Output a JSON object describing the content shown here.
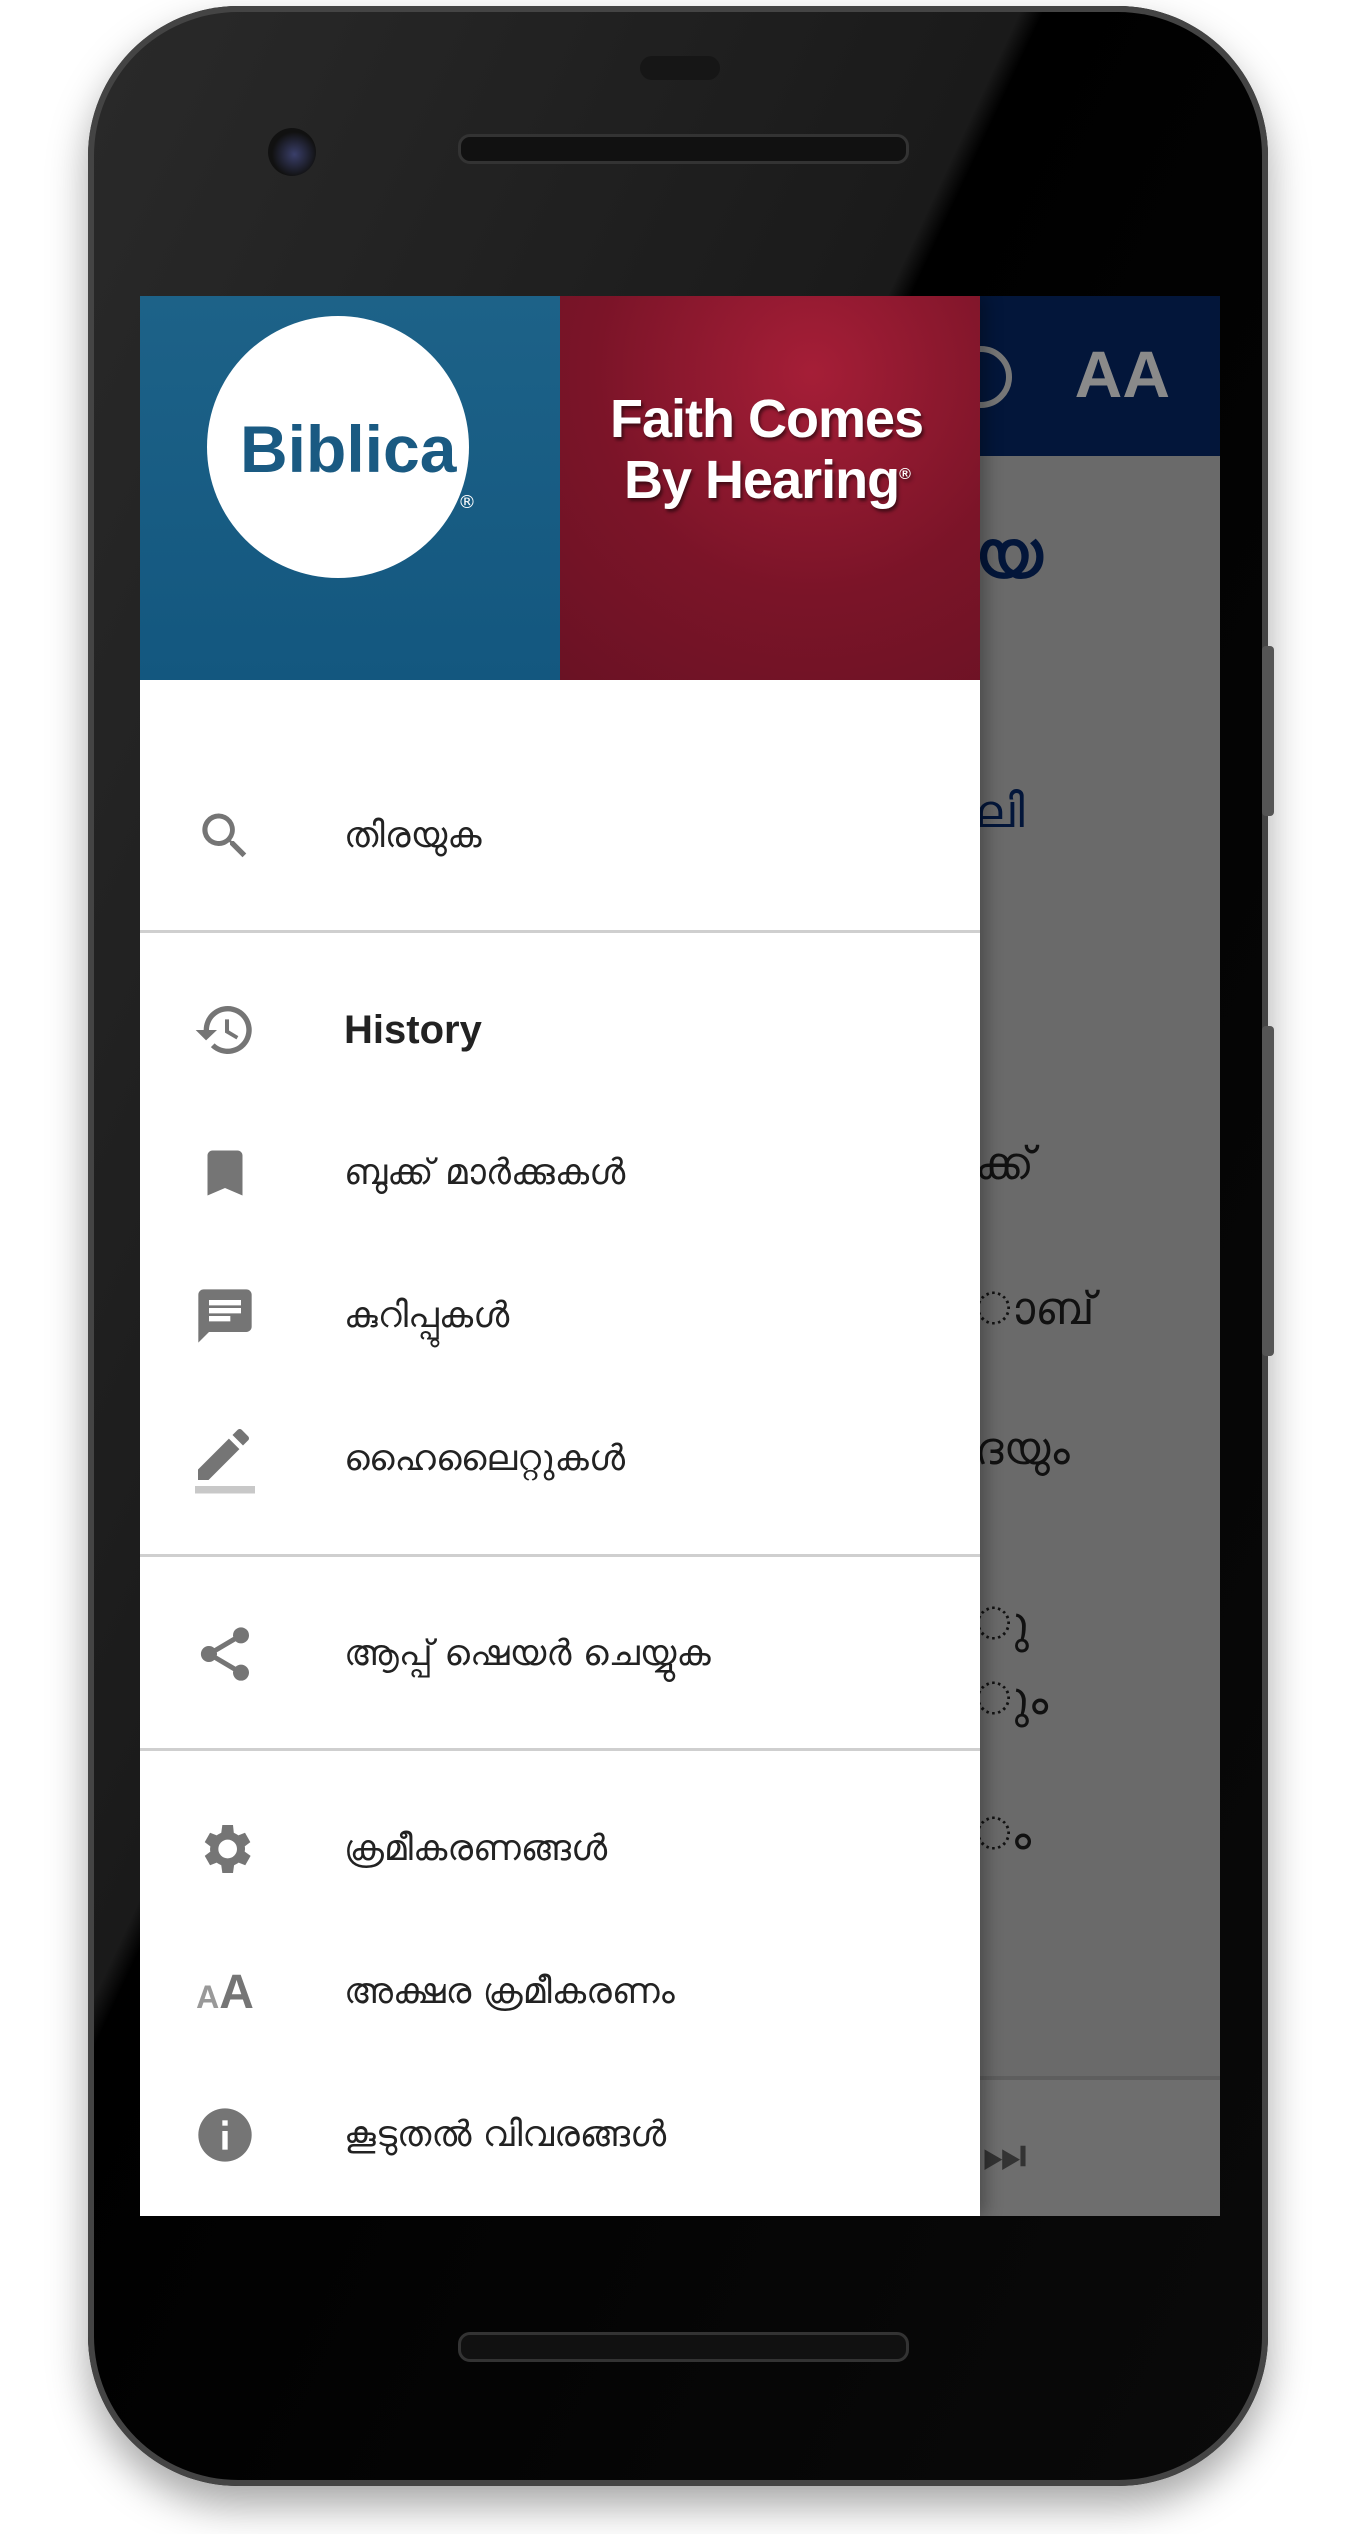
{
  "app_bar": {
    "font_icon": "AA"
  },
  "background_text": [
    "യ",
    "ലി",
    "ക്ക്",
    "ാബ്",
    "ദയും",
    "ു",
    "ും",
    "ം"
  ],
  "drawer": {
    "header": {
      "left_logo": "Biblica",
      "right_logo": "Faith Comes By Hearing",
      "colors": {
        "left": "#1d6288",
        "right": "#7b1428"
      }
    },
    "items": [
      {
        "icon": "search-icon",
        "label": "തിരയുക"
      },
      {
        "icon": "history-icon",
        "label": "History"
      },
      {
        "icon": "bookmark-icon",
        "label": "ബുക്ക് മാർക്കുകൾ"
      },
      {
        "icon": "note-icon",
        "label": "കുറിപ്പുകൾ"
      },
      {
        "icon": "highlight-icon",
        "label": "ഹൈലൈറ്റുകൾ"
      },
      {
        "icon": "share-icon",
        "label": "ആപ്പ് ഷെയർ ചെയ്യുക"
      },
      {
        "icon": "gear-icon",
        "label": "ക്രമീകരണങ്ങൾ"
      },
      {
        "icon": "font-size-icon",
        "label": "അക്ഷര ക്രമീകരണം"
      },
      {
        "icon": "info-icon",
        "label": "കൂടുതൽ വിവരങ്ങൾ"
      }
    ]
  }
}
